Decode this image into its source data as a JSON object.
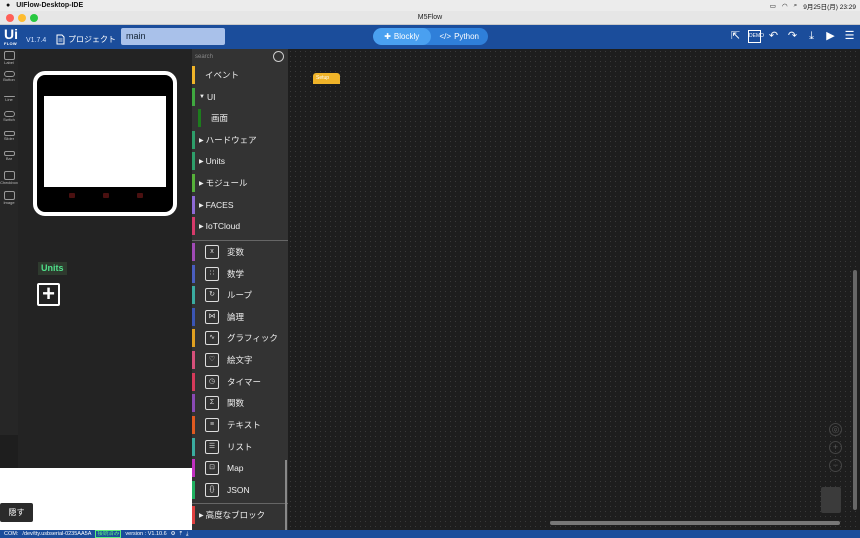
{
  "menubar": {
    "app_name": "UIFlow-Desktop-IDE",
    "datetime": "9月25日(月) 23:29"
  },
  "window": {
    "title": "M5Flow"
  },
  "header": {
    "logo": "Ui",
    "logo_sub": "FLOW",
    "version": "V1.7.4",
    "project_label": "プロジェクト",
    "project_name": "main",
    "modes": [
      "Blockly",
      "Python"
    ],
    "active_mode": "Blockly"
  },
  "tools": [
    {
      "label": "Label",
      "icon": "label-icon"
    },
    {
      "label": "Button",
      "icon": "button-icon"
    },
    {
      "label": "Line",
      "icon": "line-icon"
    },
    {
      "label": "Switch",
      "icon": "switch-icon"
    },
    {
      "label": "Slider",
      "icon": "slider-icon"
    },
    {
      "label": "Bar",
      "icon": "bar-icon"
    },
    {
      "label": "Checkbox",
      "icon": "checkbox-icon"
    },
    {
      "label": "Image",
      "icon": "image-icon"
    }
  ],
  "units": {
    "label": "Units",
    "add_symbol": "+"
  },
  "hide_button": "隠す",
  "search": {
    "placeholder": "search"
  },
  "categories": [
    {
      "label": "イベント",
      "color": "#f0b429",
      "arrow": ""
    },
    {
      "label": "UI",
      "color": "#3fa83f",
      "arrow": "▼"
    },
    {
      "label": "画面",
      "color": "#1d7c1d",
      "arrow": ""
    },
    {
      "label": "ハードウェア",
      "color": "#2e9e6a",
      "arrow": "▶"
    },
    {
      "label": "Units",
      "color": "#2e9e6a",
      "arrow": "▶"
    },
    {
      "label": "モジュール",
      "color": "#56b03a",
      "arrow": "▶"
    },
    {
      "label": "FACES",
      "color": "#8e6ad6",
      "arrow": "▶"
    },
    {
      "label": "IoTCloud",
      "color": "#d63a6a",
      "arrow": "▶"
    }
  ],
  "blocks": [
    {
      "label": "変数",
      "color": "#a04ab5",
      "icon": "x"
    },
    {
      "label": "数学",
      "color": "#4a5ec0",
      "icon": "∷"
    },
    {
      "label": "ループ",
      "color": "#3aaca0",
      "icon": "↻"
    },
    {
      "label": "論理",
      "color": "#3a55b5",
      "icon": "⋈"
    },
    {
      "label": "グラフィック",
      "color": "#e0a020",
      "icon": "∿"
    },
    {
      "label": "絵文字",
      "color": "#d6507a",
      "icon": "♡"
    },
    {
      "label": "タイマー",
      "color": "#d63a5a",
      "icon": "◷"
    },
    {
      "label": "関数",
      "color": "#8a4ab5",
      "icon": "Σ"
    },
    {
      "label": "テキスト",
      "color": "#e05a20",
      "icon": "≡"
    },
    {
      "label": "リスト",
      "color": "#3aaca0",
      "icon": "☰"
    },
    {
      "label": "Map",
      "color": "#c030c0",
      "icon": "⊡"
    },
    {
      "label": "JSON",
      "color": "#20b060",
      "icon": "{}"
    }
  ],
  "advanced": {
    "label": "高度なブロック",
    "color": "#e04040",
    "arrow": "▶"
  },
  "workspace": {
    "setup_block": "Setup"
  },
  "status": {
    "port": "COM:",
    "device": "/dev/tty.usbserial-0235AA5A",
    "connection": "接続済み",
    "version": "version : V1.10.6"
  }
}
